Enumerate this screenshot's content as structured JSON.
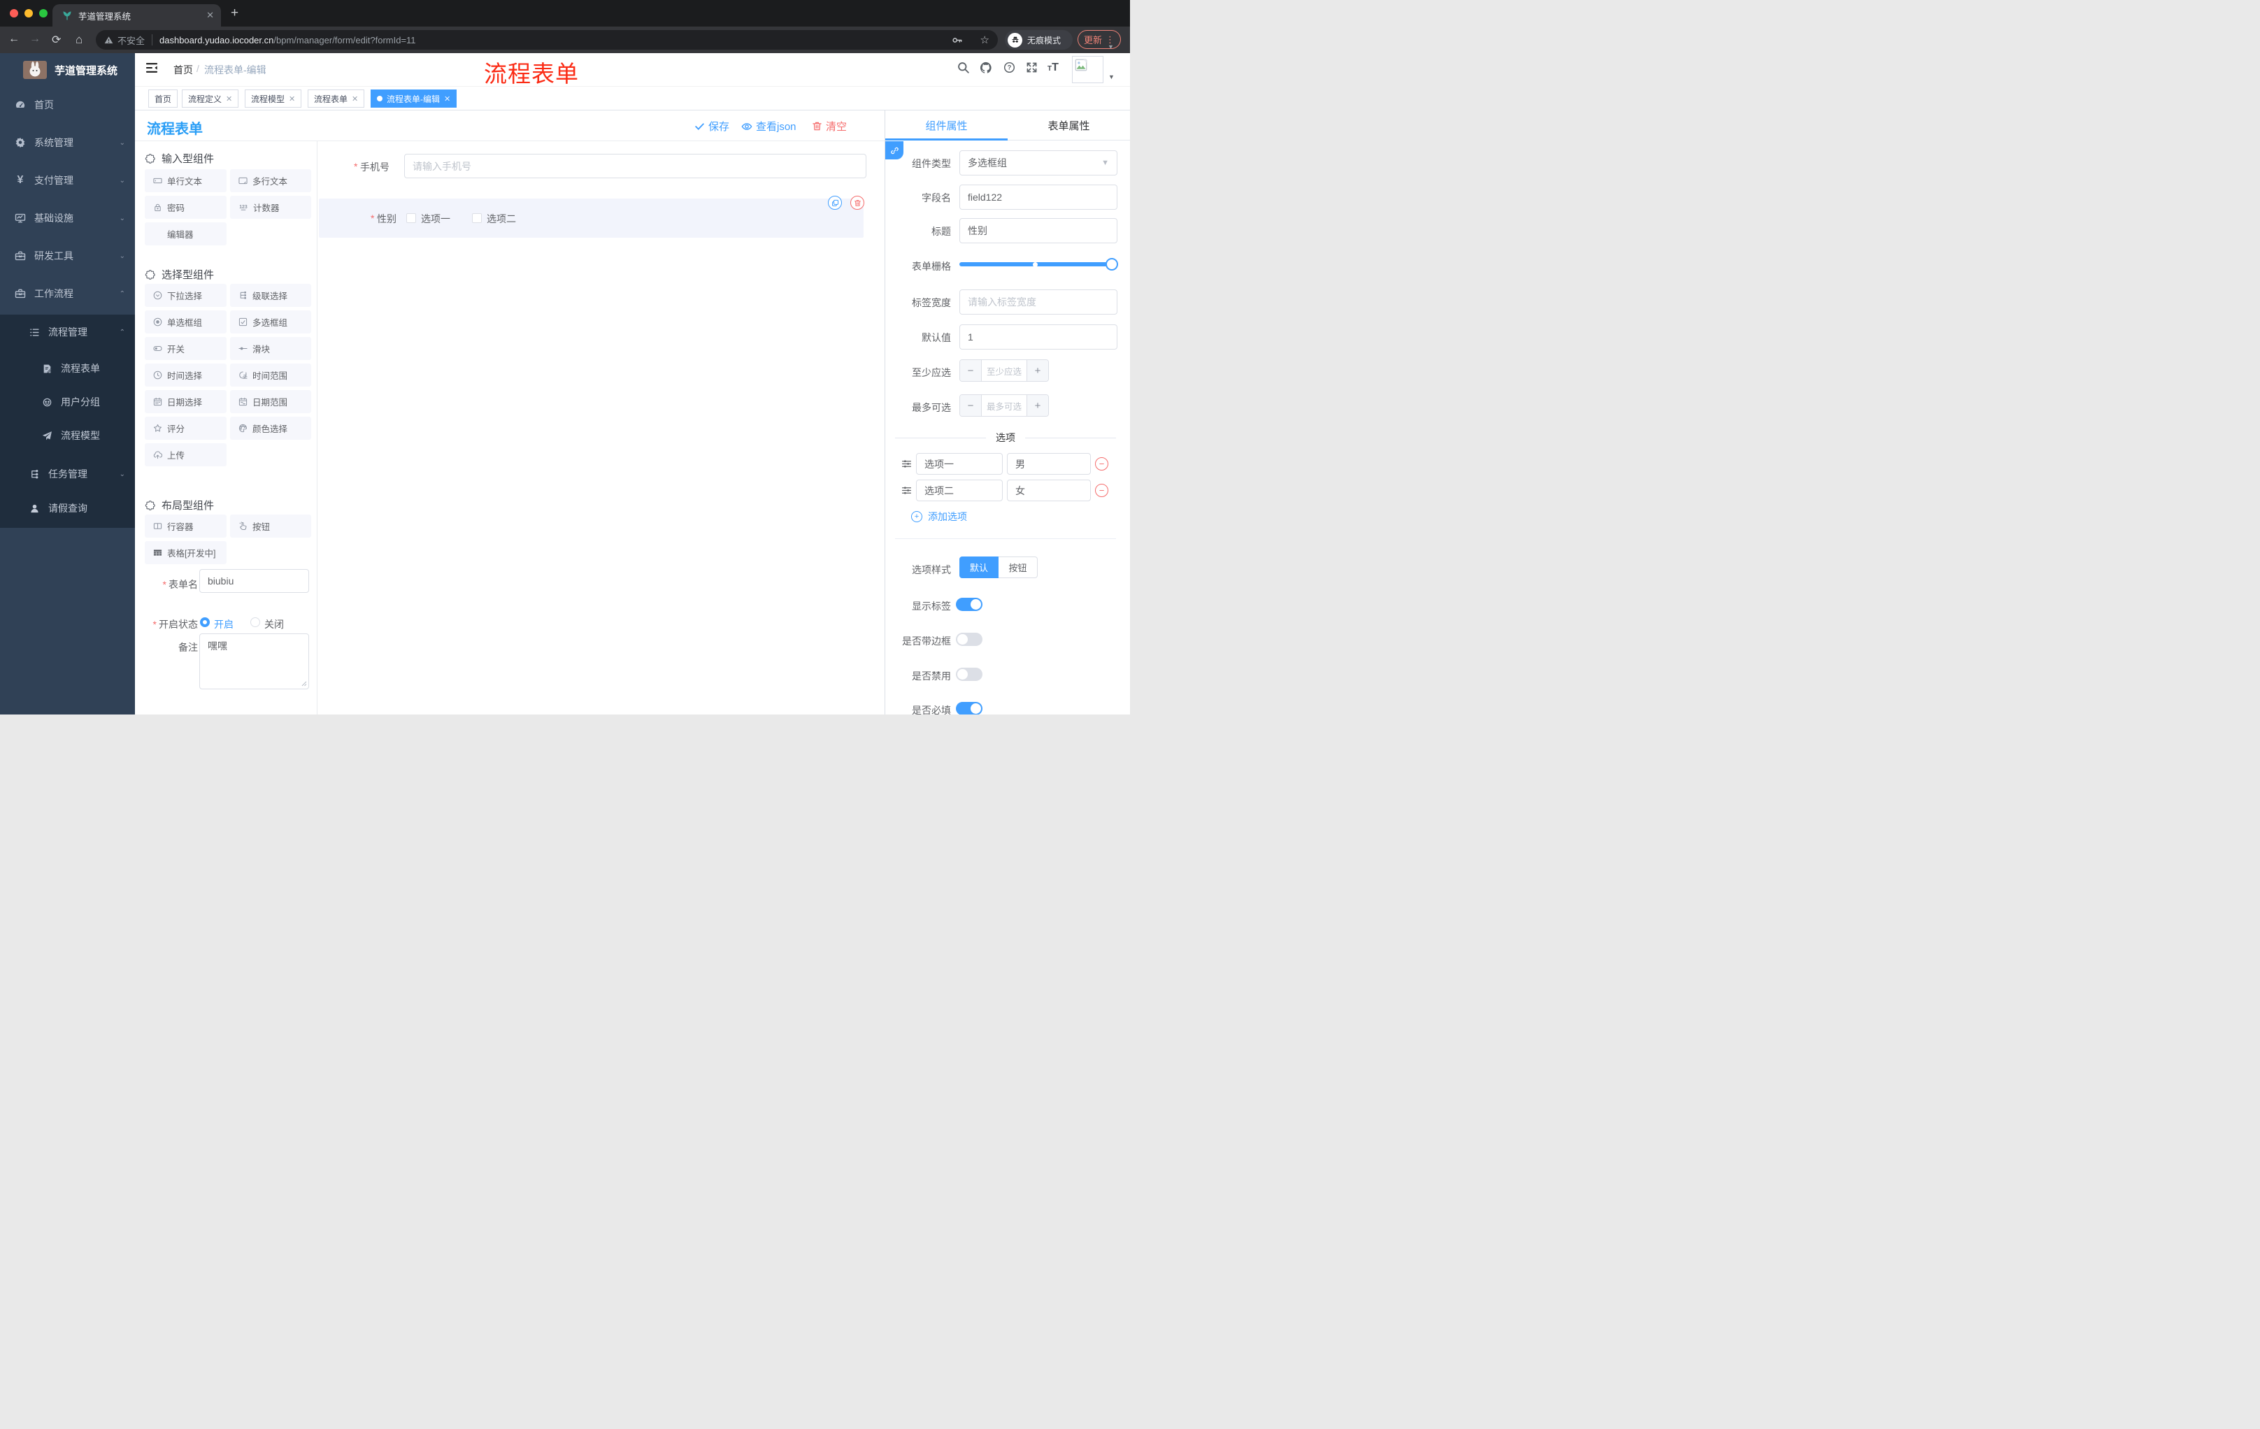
{
  "browser": {
    "tab_title": "芋道管理系统",
    "security_label": "不安全",
    "url_host": "dashboard.yudao.iocoder.cn",
    "url_path": "/bpm/manager/form/edit?formId=11",
    "incognito_label": "无痕模式",
    "update_label": "更新"
  },
  "sidebar": {
    "logo_title": "芋道管理系统",
    "home": "首页",
    "system": "系统管理",
    "pay": "支付管理",
    "infra": "基础设施",
    "dev": "研发工具",
    "workflow": "工作流程",
    "process_mgmt": "流程管理",
    "process_form": "流程表单",
    "user_group": "用户分组",
    "process_model": "流程模型",
    "task_mgmt": "任务管理",
    "leave_query": "请假查询"
  },
  "header": {
    "breadcrumb_home": "首页",
    "breadcrumb_sep": "/",
    "breadcrumb_current": "流程表单-编辑",
    "annotation": "流程表单",
    "annotation_color": "#fb2b15"
  },
  "tagbar": {
    "tabs": [
      "首页",
      "流程定义",
      "流程模型",
      "流程表单",
      "流程表单-编辑"
    ]
  },
  "builder": {
    "title": "流程表单",
    "save": "保存",
    "view_json": "查看json",
    "clear": "清空",
    "sections": {
      "input": "输入型组件",
      "select": "选择型组件",
      "layout": "布局型组件"
    },
    "components": {
      "text": "单行文本",
      "textarea": "多行文本",
      "password": "密码",
      "counter": "计数器",
      "editor": "编辑器",
      "select": "下拉选择",
      "cascader": "级联选择",
      "radio": "单选框组",
      "checkbox": "多选框组",
      "switch": "开关",
      "slider": "滑块",
      "time": "时间选择",
      "time_range": "时间范围",
      "date": "日期选择",
      "date_range": "日期范围",
      "rate": "评分",
      "color": "颜色选择",
      "upload": "上传",
      "row": "行容器",
      "button": "按钮",
      "table": "表格[开发中]"
    },
    "form": {
      "name_label": "表单名",
      "name_value": "biubiu",
      "status_label": "开启状态",
      "status_on": "开启",
      "status_off": "关闭",
      "remark_label": "备注",
      "remark_value": "嘿嘿"
    },
    "canvas": {
      "phone_label": "手机号",
      "phone_placeholder": "请输入手机号",
      "gender_label": "性别",
      "gender_option1": "选项一",
      "gender_option2": "选项二"
    }
  },
  "props": {
    "tab_component": "组件属性",
    "tab_form": "表单属性",
    "type_label": "组件类型",
    "type_value": "多选框组",
    "field_label": "字段名",
    "field_value": "field122",
    "title_label": "标题",
    "title_value": "性别",
    "grid_label": "表单栅格",
    "label_width_label": "标签宽度",
    "label_width_placeholder": "请输入标签宽度",
    "default_label": "默认值",
    "default_value": "1",
    "min_label": "至少应选",
    "min_placeholder": "至少应选",
    "max_label": "最多可选",
    "max_placeholder": "最多可选",
    "options_title": "选项",
    "options": [
      {
        "label": "选项一",
        "value": "男"
      },
      {
        "label": "选项二",
        "value": "女"
      }
    ],
    "add_option": "添加选项",
    "style_label": "选项样式",
    "style_default": "默认",
    "style_button": "按钮",
    "show_label": "显示标签",
    "border_label": "是否带边框",
    "disabled_label": "是否禁用",
    "required_label": "是否必填",
    "accent_color": "#409eff",
    "danger_color": "#f56c6c"
  }
}
